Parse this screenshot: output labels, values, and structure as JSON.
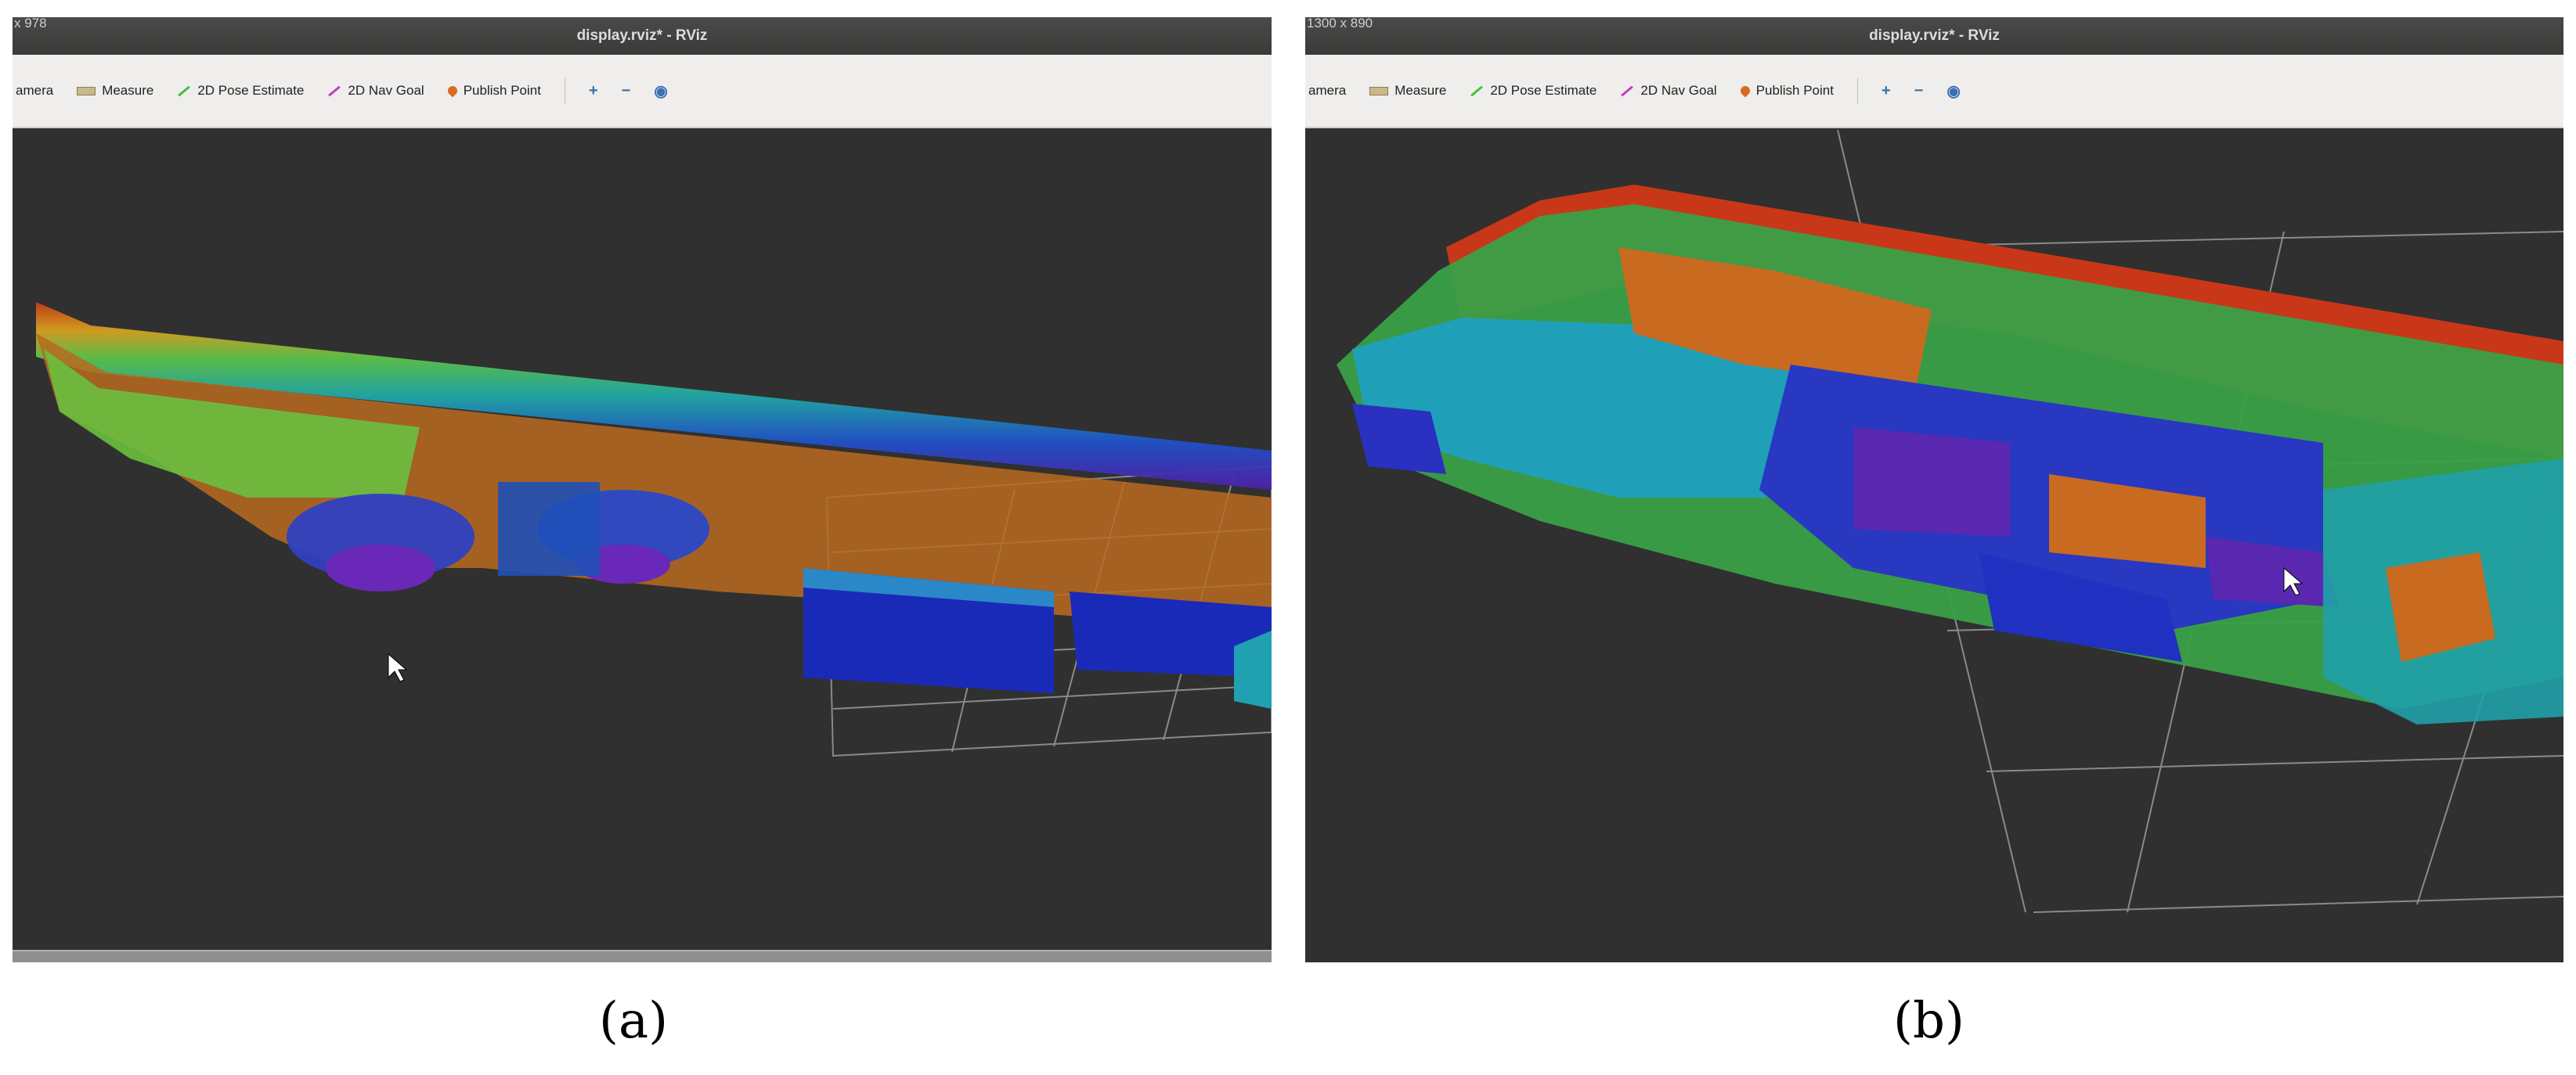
{
  "panel_a": {
    "resolution_text": "x 978",
    "window_title": "display.rviz* - RViz",
    "toolbar": {
      "camera": "amera",
      "measure": "Measure",
      "pose": "2D Pose Estimate",
      "nav": "2D Nav Goal",
      "publish": "Publish Point"
    }
  },
  "panel_b": {
    "resolution_text": "1300 x 890",
    "window_title": "display.rviz* - RViz",
    "toolbar": {
      "camera": "amera",
      "measure": "Measure",
      "pose": "2D Pose Estimate",
      "nav": "2D Nav Goal",
      "publish": "Publish Point"
    }
  },
  "captions": {
    "a": "(a)",
    "b": "(b)"
  },
  "colors": {
    "viewport_bg": "#303030",
    "toolbar_bg": "#efeeec",
    "titlebar_bg": "#3d3d3c"
  },
  "icons": [
    "measure-icon",
    "pose-estimate-icon",
    "nav-goal-icon",
    "publish-point-icon",
    "zoom-in-icon",
    "zoom-out-icon",
    "view-icon"
  ]
}
